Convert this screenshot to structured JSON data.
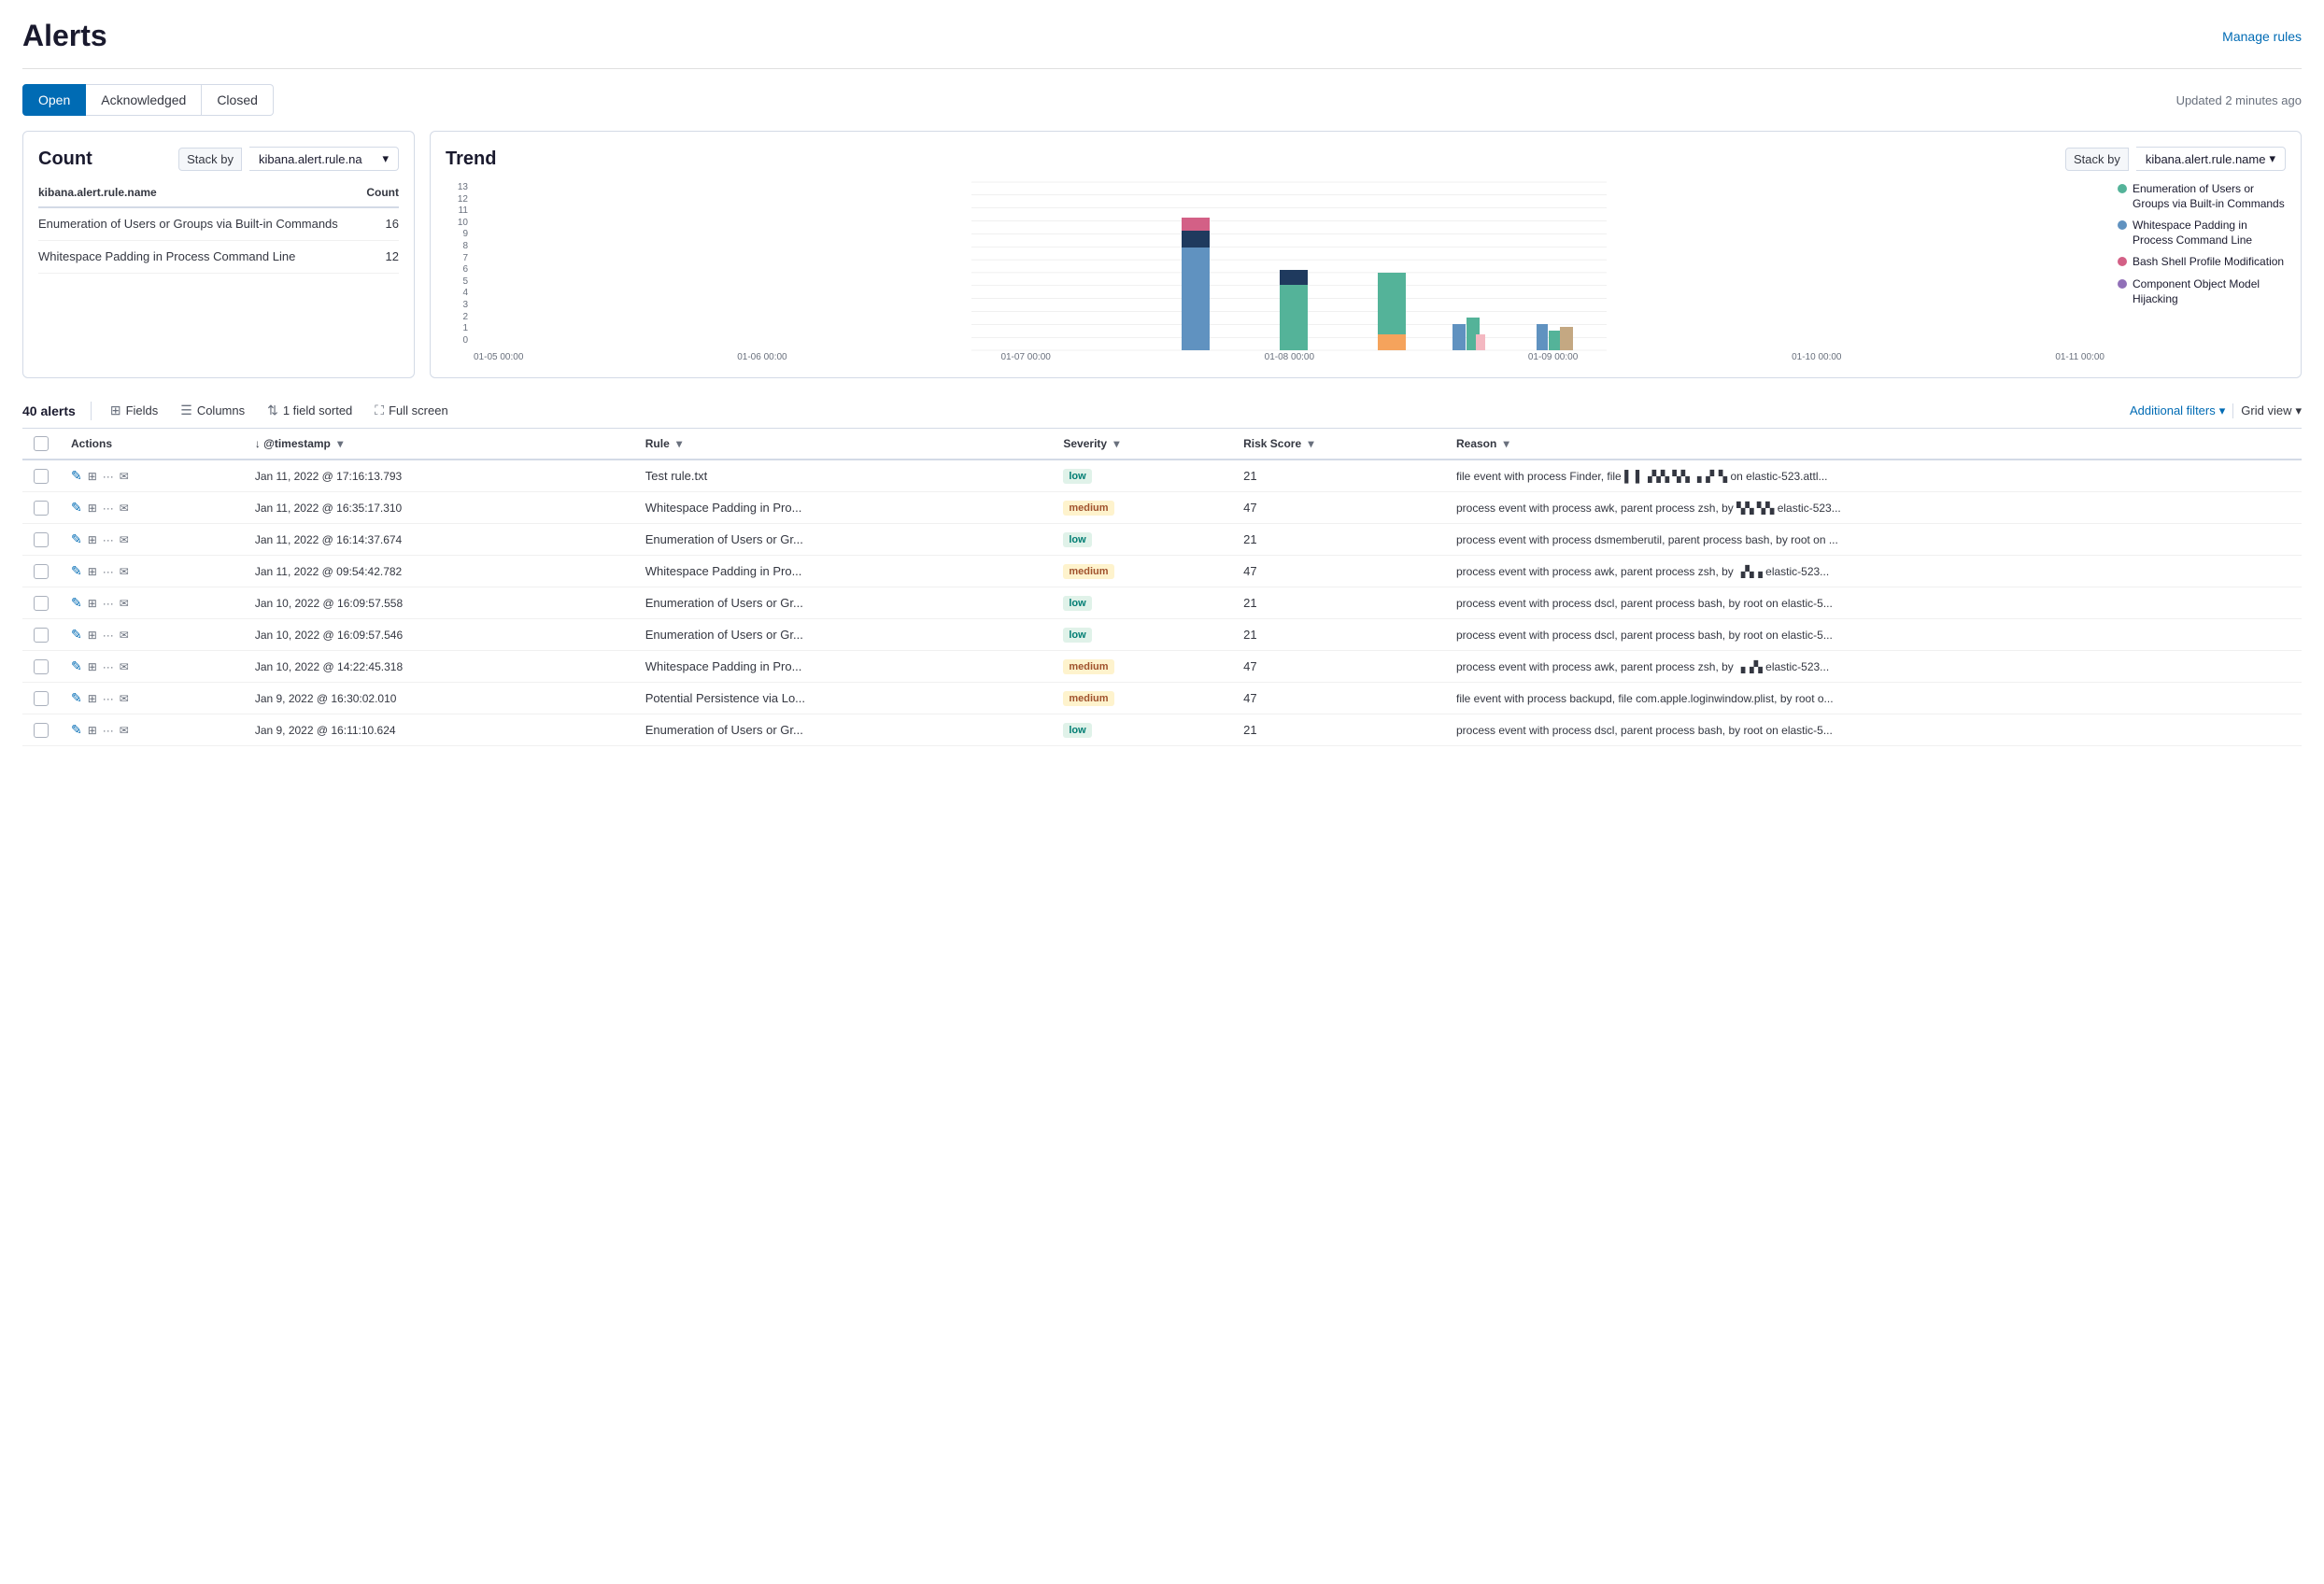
{
  "page": {
    "title": "Alerts",
    "manage_rules_label": "Manage rules",
    "updated_text": "Updated 2 minutes ago"
  },
  "tabs": [
    {
      "id": "open",
      "label": "Open",
      "active": true
    },
    {
      "id": "acknowledged",
      "label": "Acknowledged",
      "active": false
    },
    {
      "id": "closed",
      "label": "Closed",
      "active": false
    }
  ],
  "count_card": {
    "title": "Count",
    "stack_by_label": "Stack by",
    "stack_by_value": "kibana.alert.rule.na",
    "table_headers": [
      "kibana.alert.rule.name",
      "Count"
    ],
    "rows": [
      {
        "name": "Enumeration of Users or Groups via Built-in Commands",
        "count": "16"
      },
      {
        "name": "Whitespace Padding in Process Command Line",
        "count": "12"
      }
    ]
  },
  "trend_card": {
    "title": "Trend",
    "stack_by_label": "Stack by",
    "stack_by_value": "kibana.alert.rule.name",
    "x_labels": [
      "01-05 00:00",
      "01-06 00:00",
      "01-07 00:00",
      "01-08 00:00",
      "01-09 00:00",
      "01-10 00:00",
      "01-11 00:00"
    ],
    "y_labels": [
      "13",
      "12",
      "11",
      "10",
      "9",
      "8",
      "7",
      "6",
      "5",
      "4",
      "3",
      "2",
      "1",
      "0"
    ],
    "legend": [
      {
        "label": "Enumeration of Users or Groups via Built-in Commands",
        "color": "#54b399"
      },
      {
        "label": "Whitespace Padding in Process Command Line",
        "color": "#6092c0"
      },
      {
        "label": "Bash Shell Profile Modification",
        "color": "#d36086"
      },
      {
        "label": "Component Object Model Hijacking",
        "color": "#9170b8"
      }
    ]
  },
  "alerts_bar": {
    "count_label": "40 alerts",
    "fields_label": "Fields",
    "columns_label": "Columns",
    "sorted_label": "1 field sorted",
    "fullscreen_label": "Full screen",
    "additional_filters_label": "Additional filters",
    "grid_view_label": "Grid view"
  },
  "table": {
    "headers": [
      "",
      "Actions",
      "@timestamp",
      "Rule",
      "Severity",
      "Risk Score",
      "Reason"
    ],
    "rows": [
      {
        "timestamp": "Jan 11, 2022 @ 17:16:13.793",
        "rule": "Test rule.txt",
        "severity": "low",
        "risk_score": "21",
        "reason": "file event with process Finder, file ▌ ▌▗▚▚ ▚▚ ▗▗▘▚ on elastic-523.attl..."
      },
      {
        "timestamp": "Jan 11, 2022 @ 16:35:17.310",
        "rule": "Whitespace Padding in Pro...",
        "severity": "medium",
        "risk_score": "47",
        "reason": "process event with process awk, parent process zsh, by ▚▚ ▚▚ elastic-523..."
      },
      {
        "timestamp": "Jan 11, 2022 @ 16:14:37.674",
        "rule": "Enumeration of Users or Gr...",
        "severity": "low",
        "risk_score": "21",
        "reason": "process event with process dsmemberutil, parent process bash, by root on ..."
      },
      {
        "timestamp": "Jan 11, 2022 @ 09:54:42.782",
        "rule": "Whitespace Padding in Pro...",
        "severity": "medium",
        "risk_score": "47",
        "reason": "process event with process awk, parent process zsh, by ▗▚▗ elastic-523..."
      },
      {
        "timestamp": "Jan 10, 2022 @ 16:09:57.558",
        "rule": "Enumeration of Users or Gr...",
        "severity": "low",
        "risk_score": "21",
        "reason": "process event with process dscl, parent process bash, by root on elastic-5..."
      },
      {
        "timestamp": "Jan 10, 2022 @ 16:09:57.546",
        "rule": "Enumeration of Users or Gr...",
        "severity": "low",
        "risk_score": "21",
        "reason": "process event with process dscl, parent process bash, by root on elastic-5..."
      },
      {
        "timestamp": "Jan 10, 2022 @ 14:22:45.318",
        "rule": "Whitespace Padding in Pro...",
        "severity": "medium",
        "risk_score": "47",
        "reason": "process event with process awk, parent process zsh, by ▗▗▚ elastic-523..."
      },
      {
        "timestamp": "Jan 9, 2022 @ 16:30:02.010",
        "rule": "Potential Persistence via Lo...",
        "severity": "medium",
        "risk_score": "47",
        "reason": "file event with process backupd, file com.apple.loginwindow.plist, by root o..."
      },
      {
        "timestamp": "Jan 9, 2022 @ 16:11:10.624",
        "rule": "Enumeration of Users or Gr...",
        "severity": "low",
        "risk_score": "21",
        "reason": "process event with process dscl, parent process bash, by root on elastic-5..."
      }
    ]
  },
  "icons": {
    "chevron_down": "▾",
    "sort_down": "↓",
    "sort_up": "↑",
    "edit": "✎",
    "network": "⊞",
    "dots": "•••",
    "mail": "✉",
    "fields": "⊞",
    "columns": "☰",
    "sort": "⇅",
    "fullscreen": "⛶",
    "filter": "⊽"
  },
  "colors": {
    "accent": "#006bb4",
    "active_tab_bg": "#006bb4",
    "active_tab_text": "#ffffff",
    "bar_enum": "#54b399",
    "bar_whitespace": "#6092c0",
    "bar_bash": "#d36086",
    "bar_component": "#9170b8",
    "bar_extra1": "#f5a35c",
    "bar_extra2": "#e7664c",
    "bar_dark": "#1f3a5e",
    "bar_pink": "#f4b8c1"
  }
}
